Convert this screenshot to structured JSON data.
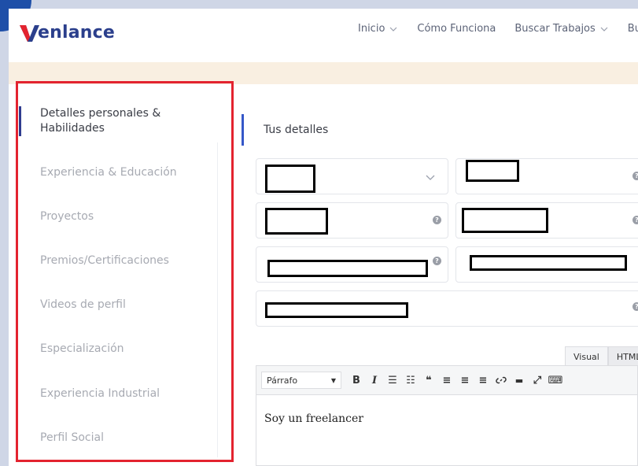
{
  "brand": {
    "logo_text": "enlance",
    "accent": "#e3232f",
    "primary": "#2b3f8c"
  },
  "nav": [
    {
      "label": "Inicio",
      "has_dropdown": true
    },
    {
      "label": "Cómo Funciona",
      "has_dropdown": false
    },
    {
      "label": "Buscar Trabajos",
      "has_dropdown": true
    },
    {
      "label": "Bu",
      "has_dropdown": false
    }
  ],
  "sidebar": {
    "items": [
      {
        "label": "Detalles personales & Habilidades",
        "active": true
      },
      {
        "label": "Experiencia & Educación",
        "active": false
      },
      {
        "label": "Proyectos",
        "active": false
      },
      {
        "label": "Premios/Certificaciones",
        "active": false
      },
      {
        "label": "Videos de perfil",
        "active": false
      },
      {
        "label": "Especialización",
        "active": false
      },
      {
        "label": "Experiencia Industrial",
        "active": false
      },
      {
        "label": "Perfil Social",
        "active": false
      }
    ]
  },
  "main": {
    "section_title": "Tus detalles",
    "help_icon": "?",
    "editor": {
      "tabs": [
        "Visual",
        "HTML"
      ],
      "format_select": "Párrafo",
      "toolbar_icons": [
        "bold-icon",
        "italic-icon",
        "bullet-list-icon",
        "numbered-list-icon",
        "blockquote-icon",
        "align-left-icon",
        "align-center-icon",
        "align-right-icon",
        "link-icon",
        "read-more-icon",
        "fullscreen-icon",
        "keyboard-icon"
      ],
      "toolbar_glyphs": [
        "B",
        "I",
        "☰",
        "☷",
        "❝",
        "≡",
        "≡",
        "≡",
        "🔗",
        "▬",
        "⤢",
        "⌨"
      ],
      "content": "Soy un freelancer"
    }
  }
}
